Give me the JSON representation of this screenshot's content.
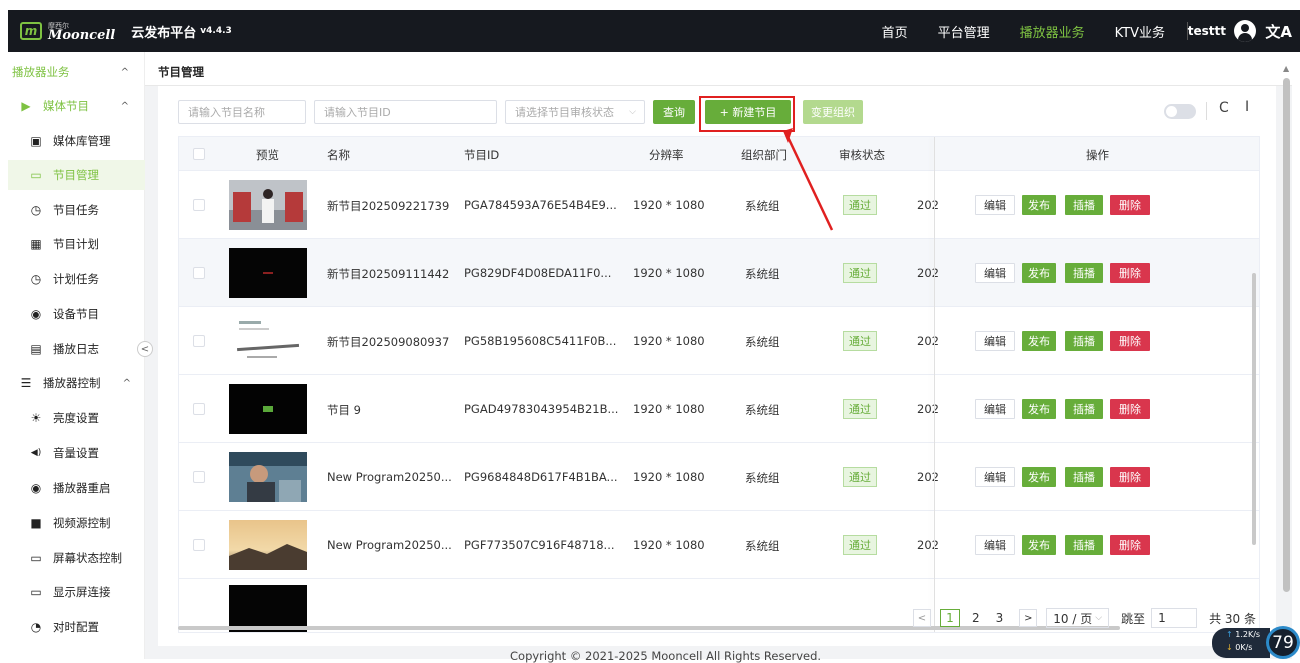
{
  "header": {
    "logo_sub": "摩西尔",
    "logo_main": "Mooncell",
    "app_title": "云发布平台",
    "version": "v4.4.3",
    "nav": [
      "首页",
      "平台管理",
      "播放器业务",
      "KTV业务"
    ],
    "username": "testtt",
    "lang_icon": "文A"
  },
  "sidebar": {
    "items": [
      {
        "label": "播放器业务",
        "icon": "",
        "chev": "^"
      },
      {
        "label": "媒体节目",
        "icon": "▶",
        "chev": "^"
      },
      {
        "label": "媒体库管理",
        "icon": "▣"
      },
      {
        "label": "节目管理",
        "icon": "▭"
      },
      {
        "label": "节目任务",
        "icon": "◷"
      },
      {
        "label": "节目计划",
        "icon": "▦"
      },
      {
        "label": "计划任务",
        "icon": "◷"
      },
      {
        "label": "设备节目",
        "icon": "◉"
      },
      {
        "label": "播放日志",
        "icon": "▤"
      },
      {
        "label": "播放器控制",
        "icon": "☰",
        "chev": "^"
      },
      {
        "label": "亮度设置",
        "icon": "☀"
      },
      {
        "label": "音量设置",
        "icon": "◀)"
      },
      {
        "label": "播放器重启",
        "icon": "◉"
      },
      {
        "label": "视频源控制",
        "icon": "■"
      },
      {
        "label": "屏幕状态控制",
        "icon": "▭"
      },
      {
        "label": "显示屏连接",
        "icon": "▭"
      },
      {
        "label": "对时配置",
        "icon": "◔"
      }
    ],
    "collapse_icon": "<"
  },
  "breadcrumb": "节目管理",
  "filters": {
    "name_placeholder": "请输入节目名称",
    "id_placeholder": "请输入节目ID",
    "status_placeholder": "请选择节目审核状态",
    "query": "查询",
    "new": "+ 新建节目",
    "change_org": "变更组织"
  },
  "table": {
    "columns": [
      "预览",
      "名称",
      "节目ID",
      "分辨率",
      "组织部门",
      "审核状态",
      "操作"
    ],
    "rows": [
      {
        "name": "新节目202509221739",
        "id": "PGA784593A76E54B4E9...",
        "res": "1920 * 1080",
        "org": "系统组",
        "status": "通过",
        "date": "202"
      },
      {
        "name": "新节目202509111442",
        "id": "PG829DF4D08EDA11F0...",
        "res": "1920 * 1080",
        "org": "系统组",
        "status": "通过",
        "date": "202"
      },
      {
        "name": "新节目202509080937",
        "id": "PG58B195608C5411F0B...",
        "res": "1920 * 1080",
        "org": "系统组",
        "status": "通过",
        "date": "202"
      },
      {
        "name": "节目 9",
        "id": "PGAD49783043954B21B...",
        "res": "1920 * 1080",
        "org": "系统组",
        "status": "通过",
        "date": "202"
      },
      {
        "name": "New Program20250...",
        "id": "PG9684848D617F4B1BA...",
        "res": "1920 * 1080",
        "org": "系统组",
        "status": "通过",
        "date": "202"
      },
      {
        "name": "New Program20250...",
        "id": "PGF773507C916F48718...",
        "res": "1920 * 1080",
        "org": "系统组",
        "status": "通过",
        "date": "202"
      }
    ],
    "ops": {
      "edit": "编辑",
      "publish": "发布",
      "insert": "插播",
      "delete": "删除"
    }
  },
  "pagination": {
    "prev": "<",
    "pages": [
      "1",
      "2",
      "3"
    ],
    "next": ">",
    "size": "10 / 页",
    "jump_label": "跳至",
    "jump_value": "1",
    "total": "共 30 条"
  },
  "footer": "Copyright © 2021-2025 Mooncell All Rights Reserved.",
  "netspeed": {
    "up": "1.2K/s",
    "down": "0K/s",
    "value": "79"
  }
}
